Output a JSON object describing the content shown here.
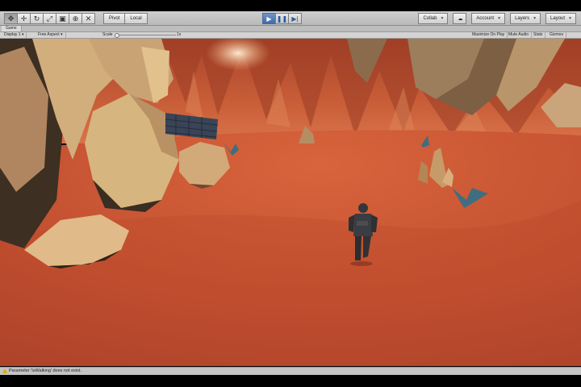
{
  "toolbar": {
    "tools": [
      "hand-tool",
      "move-tool",
      "rotate-tool",
      "scale-tool",
      "rect-tool",
      "transform-tool",
      "custom-tool"
    ],
    "pivot_label": "Pivot",
    "space_label": "Local",
    "collab_label": "Collab",
    "account_label": "Account",
    "layers_label": "Layers",
    "layout_label": "Layout"
  },
  "tab": {
    "label": "Game"
  },
  "game_bar": {
    "display_label": "Display 1",
    "aspect_label": "Free Aspect",
    "scale_label": "Scale",
    "scale_value": "1x",
    "maximize_label": "Maximize On Play",
    "mute_label": "Mute Audio",
    "stats_label": "Stats",
    "gizmos_label": "Gizmos"
  },
  "status": {
    "message": "Parameter 'IsWalking' does not exist."
  },
  "colors": {
    "ground": "#bf4d2e",
    "rock": "#d4b07c",
    "sky_cliffs": "#c25a35"
  }
}
